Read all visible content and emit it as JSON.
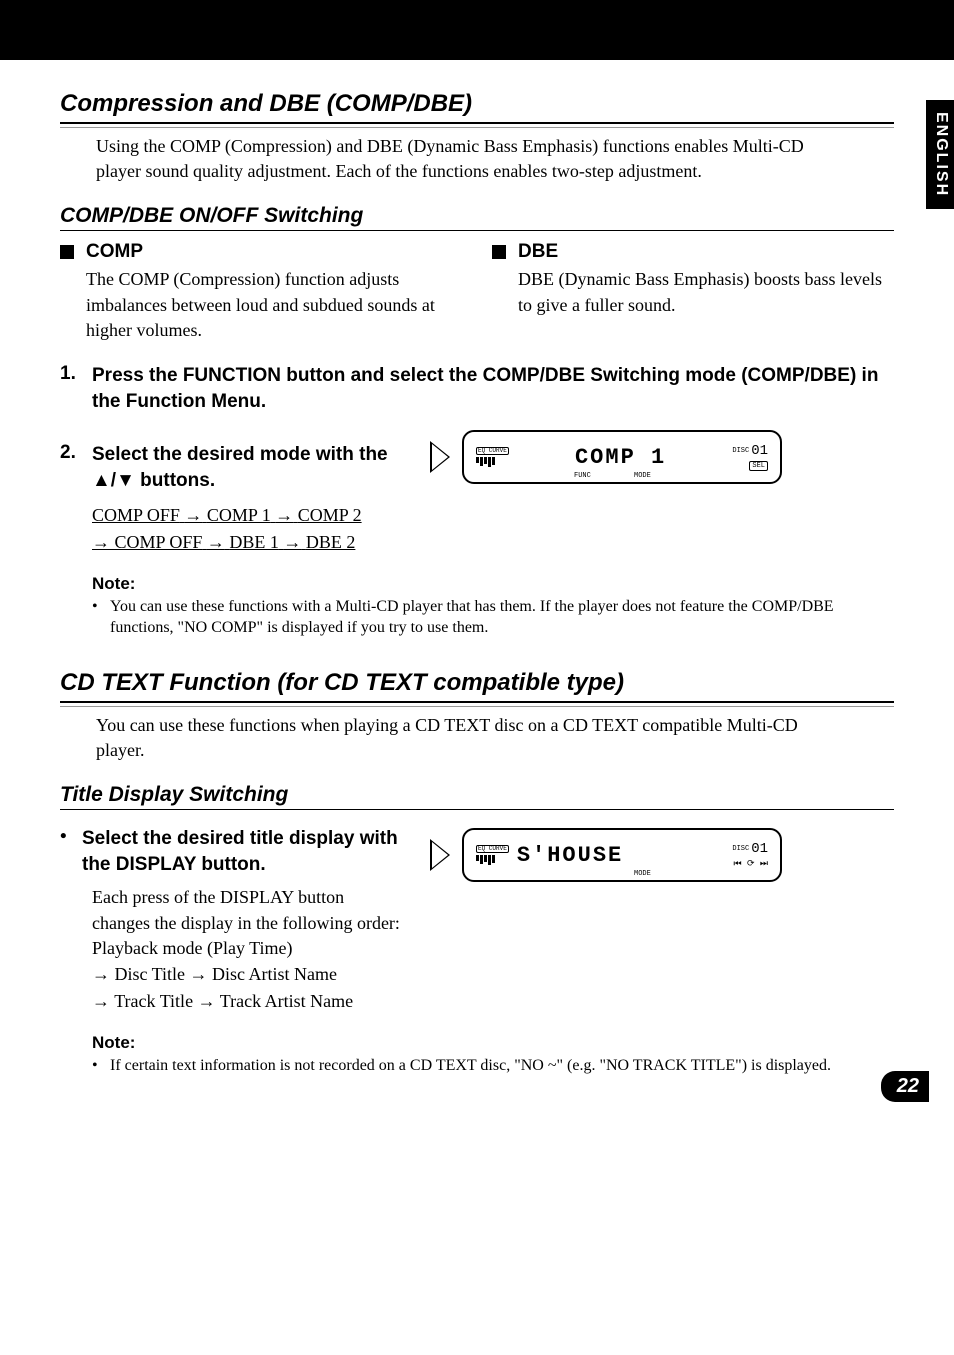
{
  "language_tab": "ENGLISH",
  "page_number": "22",
  "section1": {
    "title": "Compression and DBE (COMP/DBE)",
    "intro": "Using the COMP (Compression) and DBE (Dynamic Bass Emphasis) functions enables Multi-CD player sound quality adjustment. Each of the functions enables two-step adjustment."
  },
  "sub1": {
    "title": "COMP/DBE ON/OFF Switching",
    "comp": {
      "heading": "COMP",
      "body": "The COMP (Compression) function adjusts imbalances between loud and subdued sounds at higher volumes."
    },
    "dbe": {
      "heading": "DBE",
      "body": "DBE (Dynamic Bass Emphasis) boosts bass levels to give a fuller sound."
    },
    "step1": {
      "num": "1.",
      "text": "Press the FUNCTION button and select the COMP/DBE Switching mode (COMP/DBE) in the Function Menu."
    },
    "step2": {
      "num": "2.",
      "text_a": "Select the desired mode with the ",
      "buttons": "▲/▼",
      "text_b": " buttons.",
      "seq_items": [
        "COMP OFF",
        "COMP 1",
        "COMP 2",
        "COMP OFF",
        "DBE 1",
        "DBE 2"
      ]
    },
    "display1": {
      "eq_label": "EQ CURVE",
      "main": "COMP   1",
      "disc_label": "DISC",
      "disc_num": "01",
      "func": "FUNC",
      "mode": "MODE",
      "sel": "SEL"
    },
    "note": {
      "title": "Note:",
      "body": "You can use these functions with a Multi-CD player that has them. If the player does not feature the COMP/DBE functions, \"NO COMP\" is displayed if you try to use them."
    }
  },
  "section2": {
    "title": "CD TEXT Function (for CD TEXT compatible type)",
    "intro": "You can use these functions when playing a CD TEXT disc on a CD TEXT compatible Multi-CD player."
  },
  "sub2": {
    "title": "Title Display Switching",
    "step": {
      "text": "Select the desired title display with the DISPLAY button.",
      "body_a": "Each press of the DISPLAY button changes the display in the following order:",
      "body_b": "Playback mode (Play Time)",
      "seq_line1": [
        "Disc Title",
        "Disc Artist Name"
      ],
      "seq_line2": [
        "Track Title",
        "Track Artist Name"
      ]
    },
    "display2": {
      "eq_label": "EQ CURVE",
      "main": "S'HOUSE",
      "disc_label": "DISC",
      "disc_num": "01",
      "mode": "MODE"
    },
    "note": {
      "title": "Note:",
      "body": "If certain text information is not recorded on a CD TEXT disc, \"NO ~\" (e.g. \"NO TRACK TITLE\") is displayed."
    }
  }
}
